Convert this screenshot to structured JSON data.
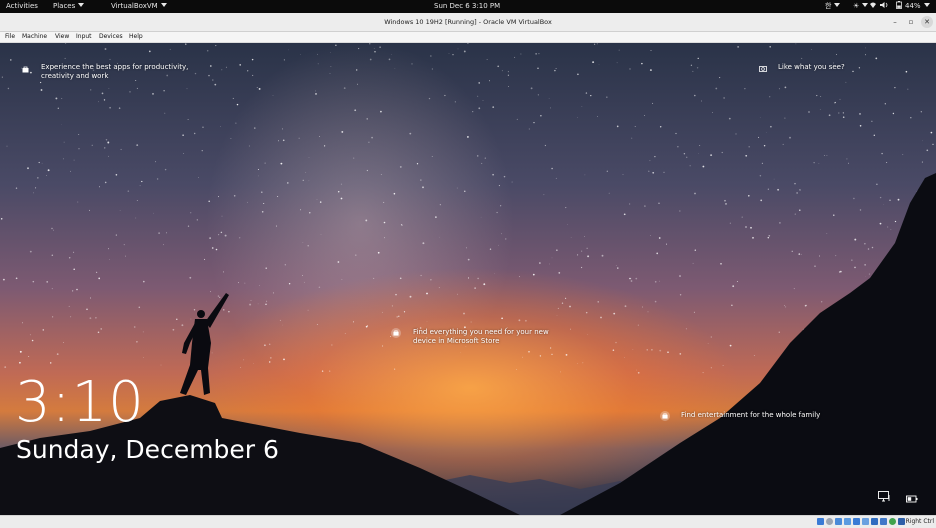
{
  "topbar": {
    "activities": "Activities",
    "places": "Places",
    "app_menu": "VirtualBoxVM",
    "datetime": "Sun Dec 6  3:10 PM",
    "input_method": "한",
    "battery_pct": "44%"
  },
  "window": {
    "title": "Windows 10 19H2 [Running] - Oracle VM VirtualBox",
    "minimize": "–",
    "restore": "▫",
    "close": "✕"
  },
  "menubar": {
    "items": [
      "File",
      "Machine",
      "View",
      "Input",
      "Devices",
      "Help"
    ]
  },
  "lockscreen": {
    "tip_top_left": "Experience the best apps for productivity, creativity and work",
    "tip_top_right": "Like what you see?",
    "tip_center": "Find everything you need for your new device in Microsoft Store",
    "tip_lower_right": "Find entertainment for the whole family",
    "time": "3:10",
    "date": "Sunday, December 6"
  },
  "statusbar": {
    "host_key": "Right Ctrl"
  },
  "colors": {
    "topbar_bg": "#0b0b0b",
    "titlebar_bg": "#ededed",
    "status_icon_blue": "#3a7bd5"
  }
}
